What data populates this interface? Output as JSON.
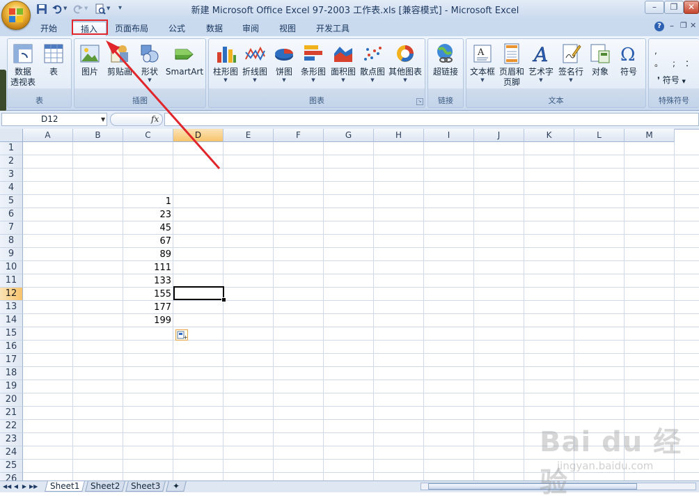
{
  "window": {
    "title": "新建 Microsoft Office Excel 97-2003 工作表.xls  [兼容模式] - Microsoft Excel",
    "minimize_label": "–",
    "restore_label": "❐",
    "close_label": "✕"
  },
  "tabs": [
    {
      "label": "开始"
    },
    {
      "label": "插入",
      "active": true
    },
    {
      "label": "页面布局"
    },
    {
      "label": "公式"
    },
    {
      "label": "数据"
    },
    {
      "label": "审阅"
    },
    {
      "label": "视图"
    },
    {
      "label": "开发工具"
    }
  ],
  "ribbon": {
    "groups": {
      "table": {
        "label": "表",
        "buttons": [
          {
            "label": "数据\n透视表",
            "icon": "pivot-table-icon"
          },
          {
            "label": "表",
            "icon": "table-icon"
          }
        ]
      },
      "illustrations": {
        "label": "插图",
        "buttons": [
          {
            "label": "图片",
            "icon": "picture-icon"
          },
          {
            "label": "剪贴画",
            "icon": "clip-art-icon"
          },
          {
            "label": "形状",
            "icon": "shapes-icon"
          },
          {
            "label": "SmartArt",
            "icon": "smartart-icon"
          }
        ]
      },
      "charts": {
        "label": "图表",
        "buttons": [
          {
            "label": "柱形图",
            "icon": "column-chart-icon"
          },
          {
            "label": "折线图",
            "icon": "line-chart-icon"
          },
          {
            "label": "饼图",
            "icon": "pie-chart-icon"
          },
          {
            "label": "条形图",
            "icon": "bar-chart-icon"
          },
          {
            "label": "面积图",
            "icon": "area-chart-icon"
          },
          {
            "label": "散点图",
            "icon": "scatter-chart-icon"
          },
          {
            "label": "其他图表",
            "icon": "other-charts-icon"
          }
        ]
      },
      "links": {
        "label": "链接",
        "buttons": [
          {
            "label": "超链接",
            "icon": "hyperlink-icon"
          }
        ]
      },
      "text": {
        "label": "文本",
        "buttons": [
          {
            "label": "文本框",
            "icon": "textbox-icon"
          },
          {
            "label": "页眉和\n页脚",
            "icon": "header-footer-icon"
          },
          {
            "label": "艺术字",
            "icon": "wordart-icon"
          },
          {
            "label": "签名行",
            "icon": "signature-line-icon"
          },
          {
            "label": "对象",
            "icon": "object-icon"
          },
          {
            "label": "符号",
            "icon": "symbol-icon"
          }
        ]
      },
      "special": {
        "label": "特殊符号",
        "buttons": [
          {
            "label": "符号",
            "icon": "special-symbol-icon"
          }
        ]
      }
    }
  },
  "formula_bar": {
    "name_box": "D12",
    "fx_label": "fx",
    "formula": ""
  },
  "grid": {
    "columns": [
      "A",
      "B",
      "C",
      "D",
      "E",
      "F",
      "G",
      "H",
      "I",
      "J",
      "K",
      "L",
      "M"
    ],
    "rows": [
      "1",
      "2",
      "3",
      "4",
      "5",
      "6",
      "7",
      "8",
      "9",
      "10",
      "11",
      "12",
      "13",
      "14",
      "15",
      "16",
      "17",
      "18",
      "19",
      "20",
      "21",
      "22",
      "23",
      "24",
      "25",
      "26"
    ],
    "selected_cell": "D12",
    "column_c_values": [
      {
        "row": 5,
        "value": "1"
      },
      {
        "row": 6,
        "value": "23"
      },
      {
        "row": 7,
        "value": "45"
      },
      {
        "row": 8,
        "value": "67"
      },
      {
        "row": 9,
        "value": "89"
      },
      {
        "row": 10,
        "value": "111"
      },
      {
        "row": 11,
        "value": "133"
      },
      {
        "row": 12,
        "value": "155"
      },
      {
        "row": 13,
        "value": "177"
      },
      {
        "row": 14,
        "value": "199"
      }
    ]
  },
  "sheets": [
    "Sheet1",
    "Sheet2",
    "Sheet3"
  ],
  "active_sheet": "Sheet1",
  "annotation": {
    "highlight_color": "#e0252b"
  },
  "watermark": {
    "text": "Bai du 经验",
    "url": "jingyan.baidu.com"
  }
}
